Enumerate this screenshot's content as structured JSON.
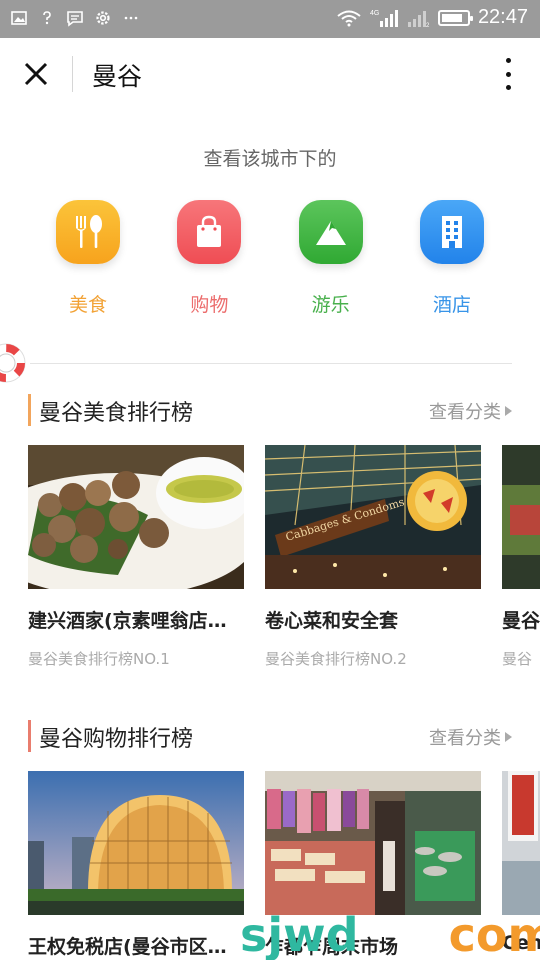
{
  "status_bar": {
    "time": "22:47",
    "network": "4G",
    "battery_level": 0.85,
    "icons": [
      "image-icon",
      "question-icon",
      "message-icon",
      "settings-icon",
      "more-dots-icon",
      "wifi-icon",
      "signal-icon",
      "signal-2-icon",
      "battery-icon"
    ]
  },
  "header": {
    "title": "曼谷",
    "close_icon": "close-icon",
    "more_icon": "more-vertical-icon"
  },
  "categories": {
    "subtitle": "查看该城市下的",
    "items": [
      {
        "label": "美食",
        "icon": "fork-knife-icon",
        "color": "#f8a41c",
        "text_color": "#f2a235"
      },
      {
        "label": "购物",
        "icon": "shopping-bag-icon",
        "color": "#f2595e",
        "text_color": "#ec6d6d"
      },
      {
        "label": "游乐",
        "icon": "mountain-icon",
        "color": "#3cb23e",
        "text_color": "#48b04c"
      },
      {
        "label": "酒店",
        "icon": "building-icon",
        "color": "#2a8ff0",
        "text_color": "#3894e8"
      }
    ]
  },
  "sections": [
    {
      "title": "曼谷美食排行榜",
      "more_label": "查看分类",
      "accent": "#f2a55c",
      "cards": [
        {
          "name": "建兴酒家(京素哩翁店…",
          "rank": "曼谷美食排行榜NO.1"
        },
        {
          "name": "卷心菜和安全套",
          "rank": "曼谷美食排行榜NO.2"
        },
        {
          "name": "曼谷",
          "rank": "曼谷"
        }
      ]
    },
    {
      "title": "曼谷购物排行榜",
      "more_label": "查看分类",
      "accent": "#e97d6e",
      "cards": [
        {
          "name": "王权免税店(曼谷市区…",
          "rank": ""
        },
        {
          "name": "乍都乍周末市场",
          "rank": ""
        },
        {
          "name": "Cent",
          "rank": ""
        }
      ]
    }
  ],
  "watermark": {
    "text_a": "sjwd",
    "text_b": "com"
  },
  "restaurant_sign_text": "Cabbages & Condoms"
}
